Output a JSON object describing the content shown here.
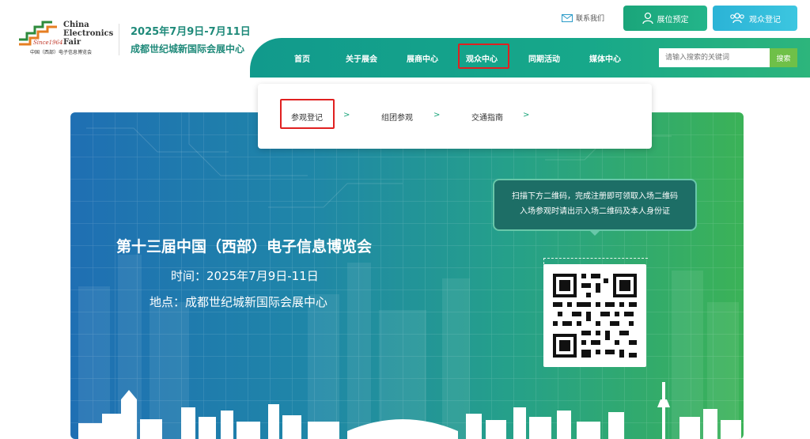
{
  "header": {
    "logo": {
      "text_line1": "China",
      "text_line2": "Electronics",
      "text_line3": "Fair",
      "since": "Since1964",
      "cn_name": "中国（西部）电子信息博览会"
    },
    "event_date": "2025年7月9日-7月11日",
    "event_venue": "成都世纪城新国际会展中心",
    "contact_label": "联系我们",
    "booth_button": "展位预定",
    "visitor_button": "观众登记"
  },
  "nav": {
    "items": [
      "首页",
      "关于展会",
      "展商中心",
      "观众中心",
      "同期活动",
      "媒体中心"
    ],
    "active_index": 3,
    "search_placeholder": "请输入搜索的关键词",
    "search_button": "搜索"
  },
  "dropdown": {
    "items": [
      "参观登记",
      "组团参观",
      "交通指南"
    ],
    "arrow": ">",
    "highlighted_index": 0
  },
  "banner": {
    "headline": "第十三届中国（西部）电子信息博览会",
    "time_line": "时间：2025年7月9日-11日",
    "place_line": "地点：成都世纪城新国际会展中心",
    "tip_line1": "扫描下方二维码，完成注册即可领取入场二维码",
    "tip_line2": "入场参观时请出示入场二维码及本人身份证"
  },
  "colors": {
    "nav_green": "#17a88a",
    "highlight_red": "#e02020",
    "booth_button": "#1aa57a",
    "visitor_button": "#2bb3d6"
  }
}
